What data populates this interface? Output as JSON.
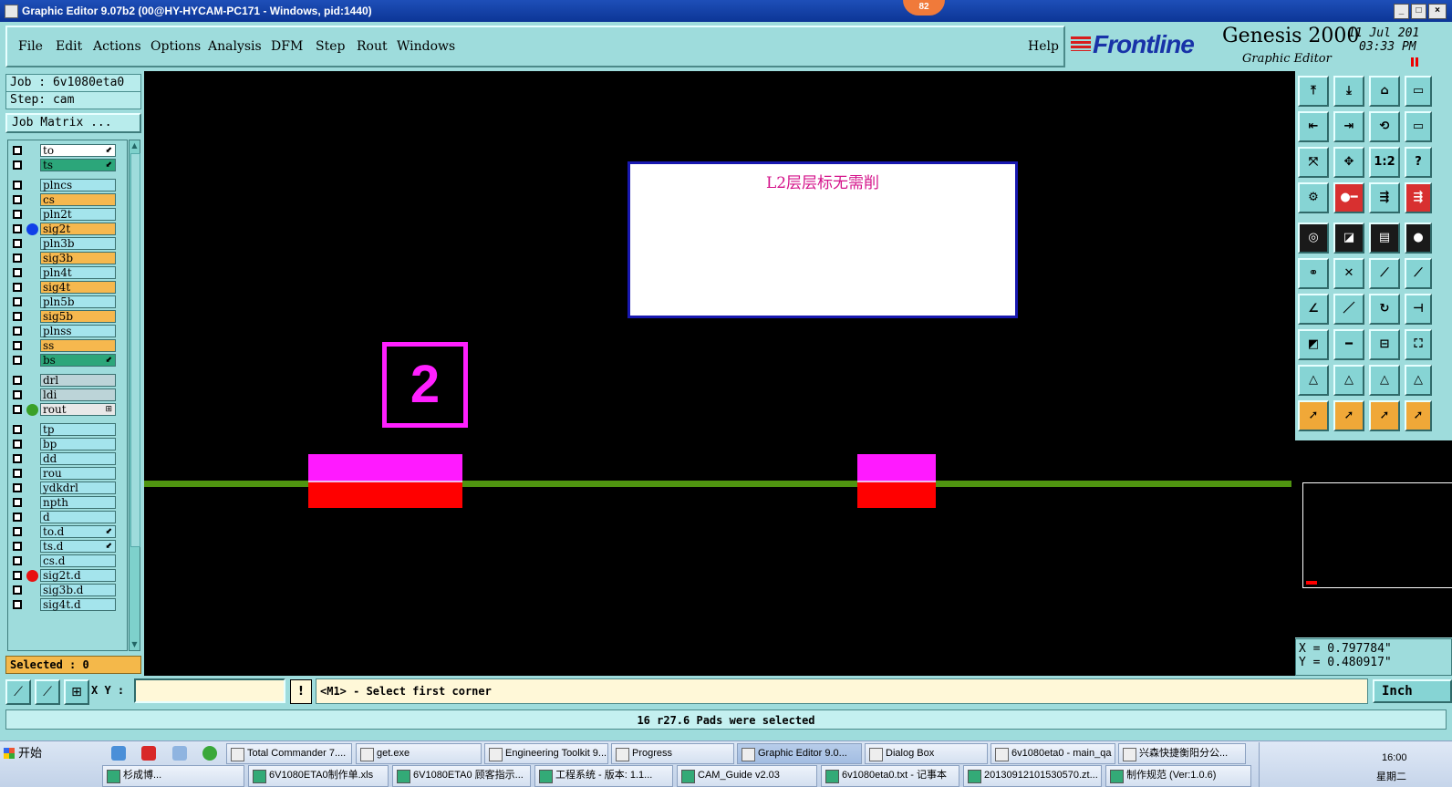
{
  "window": {
    "title": "Graphic Editor 9.07b2 (00@HY-HYCAM-PC171 - Windows, pid:1440)",
    "badge": "82",
    "min_label": "_",
    "max_label": "□",
    "close_label": "×"
  },
  "menu": {
    "items": [
      "File",
      "Edit",
      "Actions",
      "Options",
      "Analysis",
      "DFM",
      "Step",
      "Rout",
      "Windows"
    ],
    "help": "Help"
  },
  "brand": {
    "logo": "Frontline",
    "product": "Genesis 2000",
    "subtitle": "Graphic Editor",
    "date": "11 Jul 201",
    "time": "03:33 PM"
  },
  "job": {
    "job_line": "Job : 6v1080eta0",
    "step_line": "Step: cam",
    "matrix_button": "Job Matrix ...",
    "selected": "Selected : 0"
  },
  "layers": [
    {
      "name": "to",
      "color": "#ffffff",
      "mark": "⬋",
      "dot": ""
    },
    {
      "name": "ts",
      "color": "#2ca67a",
      "mark": "⬋",
      "dot": ""
    },
    {
      "name": "plncs",
      "color": "#a4e4ec",
      "mark": "",
      "dot": ""
    },
    {
      "name": "cs",
      "color": "#f6b84e",
      "mark": "",
      "dot": ""
    },
    {
      "name": "pln2t",
      "color": "#a4e4ec",
      "mark": "",
      "dot": ""
    },
    {
      "name": "sig2t",
      "color": "#f6b84e",
      "mark": "",
      "dot": "#1040e8"
    },
    {
      "name": "pln3b",
      "color": "#a4e4ec",
      "mark": "",
      "dot": ""
    },
    {
      "name": "sig3b",
      "color": "#f6b84e",
      "mark": "",
      "dot": ""
    },
    {
      "name": "pln4t",
      "color": "#a4e4ec",
      "mark": "",
      "dot": ""
    },
    {
      "name": "sig4t",
      "color": "#f6b84e",
      "mark": "",
      "dot": ""
    },
    {
      "name": "pln5b",
      "color": "#a4e4ec",
      "mark": "",
      "dot": ""
    },
    {
      "name": "sig5b",
      "color": "#f6b84e",
      "mark": "",
      "dot": ""
    },
    {
      "name": "plnss",
      "color": "#a4e4ec",
      "mark": "",
      "dot": ""
    },
    {
      "name": "ss",
      "color": "#f6b84e",
      "mark": "",
      "dot": ""
    },
    {
      "name": "bs",
      "color": "#2ca67a",
      "mark": "⬋",
      "dot": ""
    },
    {
      "name": "drl",
      "color": "#bcd4d8",
      "mark": "",
      "dot": ""
    },
    {
      "name": "ldi",
      "color": "#bcd4d8",
      "mark": "",
      "dot": ""
    },
    {
      "name": "rout",
      "color": "#e8e8e8",
      "mark": "⊞",
      "dot": "#3aa028"
    },
    {
      "name": "tp",
      "color": "#a4e4ec",
      "mark": "",
      "dot": ""
    },
    {
      "name": "bp",
      "color": "#a4e4ec",
      "mark": "",
      "dot": ""
    },
    {
      "name": "dd",
      "color": "#a4e4ec",
      "mark": "",
      "dot": ""
    },
    {
      "name": "rou",
      "color": "#a4e4ec",
      "mark": "",
      "dot": ""
    },
    {
      "name": "ydkdrl",
      "color": "#a4e4ec",
      "mark": "",
      "dot": ""
    },
    {
      "name": "npth",
      "color": "#a4e4ec",
      "mark": "",
      "dot": ""
    },
    {
      "name": "d",
      "color": "#a4e4ec",
      "mark": "",
      "dot": ""
    },
    {
      "name": "to.d",
      "color": "#a4e4ec",
      "mark": "⬋",
      "dot": ""
    },
    {
      "name": "ts.d",
      "color": "#a4e4ec",
      "mark": "⬋",
      "dot": ""
    },
    {
      "name": "cs.d",
      "color": "#a4e4ec",
      "mark": "",
      "dot": ""
    },
    {
      "name": "sig2t.d",
      "color": "#a4e4ec",
      "mark": "",
      "dot": "#e81010"
    },
    {
      "name": "sig3b.d",
      "color": "#a4e4ec",
      "mark": "",
      "dot": ""
    },
    {
      "name": "sig4t.d",
      "color": "#a4e4ec",
      "mark": "",
      "dot": ""
    }
  ],
  "canvas": {
    "note_text": "L2层层标无需削",
    "label_number": "2"
  },
  "toolbox": {
    "glyphs": [
      "⤒",
      "⤓",
      "⌂",
      "▭",
      "⇤",
      "⇥",
      "⟲",
      "▭",
      "⤧",
      "✥",
      "1:2",
      "?",
      "⚙",
      "●━",
      "⇶",
      "⇶",
      "◎",
      "◪",
      "▤",
      "●",
      "⚭",
      "✕",
      "⟋",
      "⟋",
      "∠",
      "／",
      "↻",
      "⊣",
      "◩",
      "━",
      "⊟",
      "⛶",
      "△",
      "△",
      "△",
      "△",
      "➚",
      "➚",
      "➚",
      "➚"
    ]
  },
  "coords": {
    "x": "X = 0.797784\"",
    "y": "Y = 0.480917\""
  },
  "command": {
    "xy_label": "X Y :",
    "xy_value": "",
    "bang": "!",
    "prompt": "<M1> - Select first corner",
    "units": "Inch"
  },
  "status": {
    "message": "16 r27.6 Pads were selected"
  },
  "taskbar": {
    "start": "开始",
    "tasks": [
      "Total Commander 7....",
      "get.exe",
      "Engineering Toolkit 9...",
      "Progress",
      "Graphic Editor 9.0...",
      "Dialog Box",
      "6v1080eta0 - main_qa",
      "兴森快捷衡阳分公..."
    ],
    "tasks_row2": [
      "杉成博...",
      "6V1080ETA0制作单.xls",
      "6V1080ETA0 顾客指示...",
      "工程系统 - 版本: 1.1...",
      "CAM_Guide v2.03",
      "6v1080eta0.txt - 记事本",
      "20130912101530570.zt...",
      "制作规范 (Ver:1.0.6)"
    ],
    "clock": "16:00",
    "day": "星期二"
  }
}
